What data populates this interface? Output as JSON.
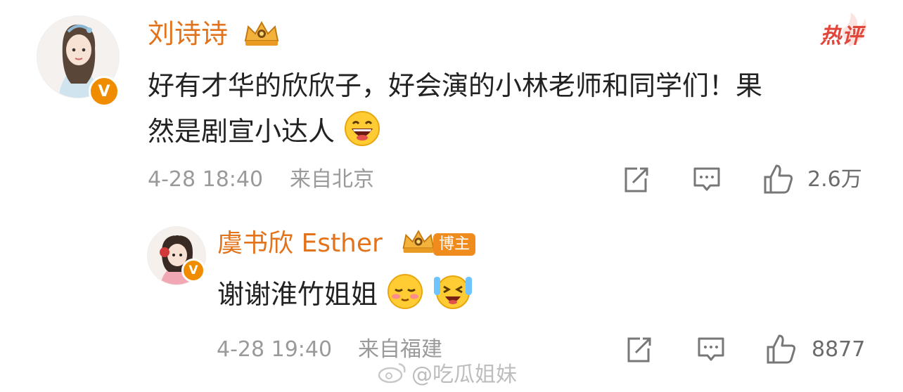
{
  "comment": {
    "username": "刘诗诗",
    "hot_label": "热评",
    "text_line1": "好有才华的欣欣子，好会演的小林老师和同学们！果",
    "text_line2": "然是剧宣小达人",
    "emoji": "grin-emoji",
    "date": "4-28 18:40",
    "location": "来自北京",
    "like_count": "2.6万"
  },
  "reply": {
    "username": "虞书欣 Esther",
    "author_badge": "博主",
    "text": "谢谢淮竹姐姐",
    "emojis": [
      "blush-emoji",
      "happy-cry-emoji"
    ],
    "date": "4-28 19:40",
    "location": "来自福建",
    "like_count": "8877"
  },
  "watermark": "@吃瓜姐妹",
  "colors": {
    "username": "#e3731b",
    "hot": "#e2463b",
    "badge": "#f08c00",
    "meta": "#9a9a9a"
  },
  "icons": {
    "forward": "share-icon",
    "comment": "comment-icon",
    "like": "thumbs-up-icon",
    "vip": "crown-icon",
    "verified": "verified-v-icon"
  }
}
